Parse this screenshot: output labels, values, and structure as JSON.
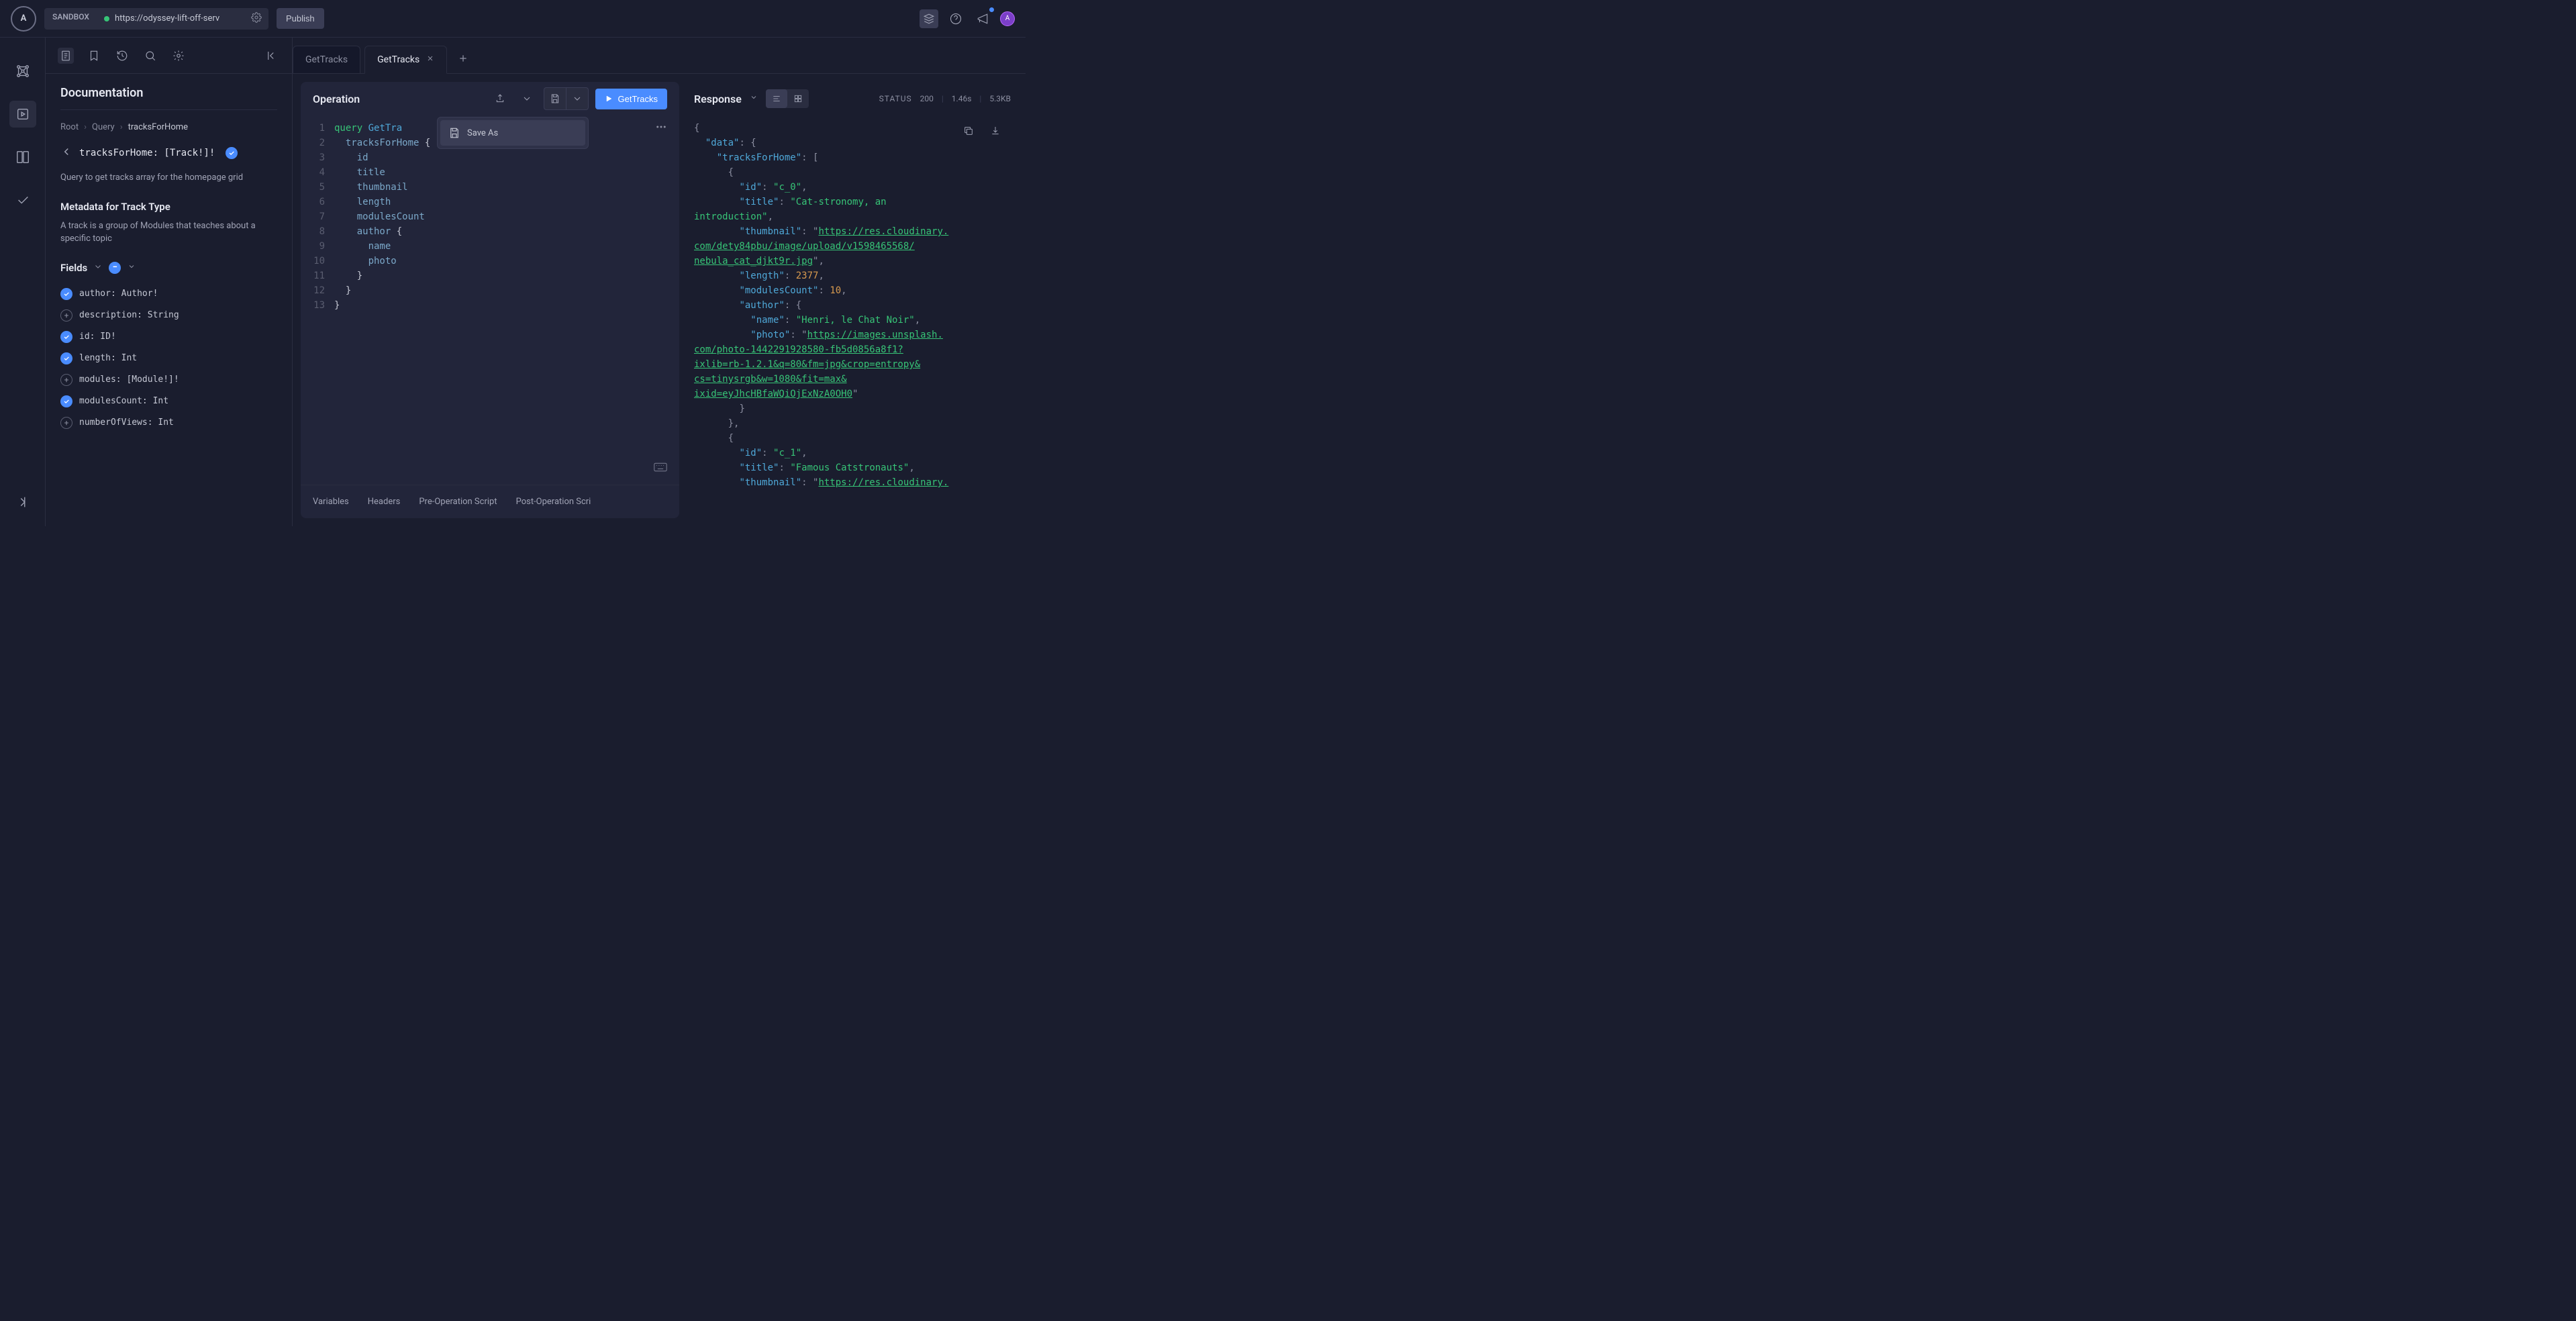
{
  "topbar": {
    "sandbox_label": "SANDBOX",
    "url": "https://odyssey-lift-off-serv",
    "publish": "Publish",
    "avatar_initial": "A"
  },
  "doc": {
    "title": "Documentation",
    "breadcrumb": [
      "Root",
      "Query",
      "tracksForHome"
    ],
    "back_signature": "tracksForHome: [Track!]!",
    "description": "Query to get tracks array for the homepage grid",
    "metadata_heading": "Metadata for Track Type",
    "metadata_desc": "A track is a group of Modules that teaches about a specific topic",
    "fields_label": "Fields",
    "fields": [
      {
        "on": true,
        "sig": "author: Author!"
      },
      {
        "on": false,
        "sig": "description: String"
      },
      {
        "on": true,
        "sig": "id: ID!"
      },
      {
        "on": true,
        "sig": "length: Int"
      },
      {
        "on": false,
        "sig": "modules: [Module!]!"
      },
      {
        "on": true,
        "sig": "modulesCount: Int"
      },
      {
        "on": false,
        "sig": "numberOfViews: Int"
      }
    ]
  },
  "tabs": {
    "items": [
      {
        "label": "GetTracks",
        "active": false
      },
      {
        "label": "GetTracks",
        "active": true
      }
    ]
  },
  "operation": {
    "title": "Operation",
    "run_label": "GetTracks",
    "save_as": "Save As",
    "code_lines": [
      [
        {
          "c": "tok-kw",
          "t": "query"
        },
        {
          "c": "",
          "t": " "
        },
        {
          "c": "tok-name",
          "t": "GetTra"
        }
      ],
      [
        {
          "c": "",
          "t": "  "
        },
        {
          "c": "tok-field",
          "t": "tracksForHome"
        },
        {
          "c": "",
          "t": " {"
        }
      ],
      [
        {
          "c": "",
          "t": "    "
        },
        {
          "c": "tok-field",
          "t": "id"
        }
      ],
      [
        {
          "c": "",
          "t": "    "
        },
        {
          "c": "tok-field",
          "t": "title"
        }
      ],
      [
        {
          "c": "",
          "t": "    "
        },
        {
          "c": "tok-field",
          "t": "thumbnail"
        }
      ],
      [
        {
          "c": "",
          "t": "    "
        },
        {
          "c": "tok-field",
          "t": "length"
        }
      ],
      [
        {
          "c": "",
          "t": "    "
        },
        {
          "c": "tok-field",
          "t": "modulesCount"
        }
      ],
      [
        {
          "c": "",
          "t": "    "
        },
        {
          "c": "tok-field",
          "t": "author"
        },
        {
          "c": "",
          "t": " {"
        }
      ],
      [
        {
          "c": "",
          "t": "      "
        },
        {
          "c": "tok-field",
          "t": "name"
        }
      ],
      [
        {
          "c": "",
          "t": "      "
        },
        {
          "c": "tok-field",
          "t": "photo"
        }
      ],
      [
        {
          "c": "",
          "t": "    }"
        }
      ],
      [
        {
          "c": "",
          "t": "  }"
        }
      ],
      [
        {
          "c": "",
          "t": "}"
        }
      ]
    ],
    "bottom_tabs": [
      "Variables",
      "Headers",
      "Pre-Operation Script",
      "Post-Operation Scri"
    ]
  },
  "response": {
    "title": "Response",
    "status_label": "STATUS",
    "status_code": "200",
    "time": "1.46s",
    "size": "5.3KB",
    "json_lines": [
      [
        {
          "c": "j-punc",
          "t": "{"
        }
      ],
      [
        {
          "c": "",
          "t": "  "
        },
        {
          "c": "j-key",
          "t": "\"data\""
        },
        {
          "c": "j-punc",
          "t": ": {"
        }
      ],
      [
        {
          "c": "",
          "t": "    "
        },
        {
          "c": "j-key",
          "t": "\"tracksForHome\""
        },
        {
          "c": "j-punc",
          "t": ": ["
        }
      ],
      [
        {
          "c": "",
          "t": "      "
        },
        {
          "c": "j-punc",
          "t": "{"
        }
      ],
      [
        {
          "c": "",
          "t": "        "
        },
        {
          "c": "j-key",
          "t": "\"id\""
        },
        {
          "c": "j-punc",
          "t": ": "
        },
        {
          "c": "j-str",
          "t": "\"c_0\""
        },
        {
          "c": "j-punc",
          "t": ","
        }
      ],
      [
        {
          "c": "",
          "t": "        "
        },
        {
          "c": "j-key",
          "t": "\"title\""
        },
        {
          "c": "j-punc",
          "t": ": "
        },
        {
          "c": "j-str",
          "t": "\"Cat-stronomy, an"
        }
      ],
      [
        {
          "c": "j-str",
          "t": "introduction\""
        },
        {
          "c": "j-punc",
          "t": ","
        }
      ],
      [
        {
          "c": "",
          "t": "        "
        },
        {
          "c": "j-key",
          "t": "\"thumbnail\""
        },
        {
          "c": "j-punc",
          "t": ": "
        },
        {
          "c": "j-punc",
          "t": "\""
        },
        {
          "c": "j-url",
          "t": "https://res.cloudinary."
        }
      ],
      [
        {
          "c": "j-url",
          "t": "com/dety84pbu/image/upload/v1598465568/"
        }
      ],
      [
        {
          "c": "j-url",
          "t": "nebula_cat_djkt9r.jpg"
        },
        {
          "c": "j-punc",
          "t": "\","
        }
      ],
      [
        {
          "c": "",
          "t": "        "
        },
        {
          "c": "j-key",
          "t": "\"length\""
        },
        {
          "c": "j-punc",
          "t": ": "
        },
        {
          "c": "j-num",
          "t": "2377"
        },
        {
          "c": "j-punc",
          "t": ","
        }
      ],
      [
        {
          "c": "",
          "t": "        "
        },
        {
          "c": "j-key",
          "t": "\"modulesCount\""
        },
        {
          "c": "j-punc",
          "t": ": "
        },
        {
          "c": "j-num",
          "t": "10"
        },
        {
          "c": "j-punc",
          "t": ","
        }
      ],
      [
        {
          "c": "",
          "t": "        "
        },
        {
          "c": "j-key",
          "t": "\"author\""
        },
        {
          "c": "j-punc",
          "t": ": {"
        }
      ],
      [
        {
          "c": "",
          "t": "          "
        },
        {
          "c": "j-key",
          "t": "\"name\""
        },
        {
          "c": "j-punc",
          "t": ": "
        },
        {
          "c": "j-str",
          "t": "\"Henri, le Chat Noir\""
        },
        {
          "c": "j-punc",
          "t": ","
        }
      ],
      [
        {
          "c": "",
          "t": "          "
        },
        {
          "c": "j-key",
          "t": "\"photo\""
        },
        {
          "c": "j-punc",
          "t": ": "
        },
        {
          "c": "j-punc",
          "t": "\""
        },
        {
          "c": "j-url",
          "t": "https://images.unsplash."
        }
      ],
      [
        {
          "c": "j-url",
          "t": "com/photo-1442291928580-fb5d0856a8f1?"
        }
      ],
      [
        {
          "c": "j-url",
          "t": "ixlib=rb-1.2.1&q=80&fm=jpg&crop=entropy&"
        }
      ],
      [
        {
          "c": "j-url",
          "t": "cs=tinysrgb&w=1080&fit=max&"
        }
      ],
      [
        {
          "c": "j-url",
          "t": "ixid=eyJhcHBfaWQiOjExNzA0OH0"
        },
        {
          "c": "j-punc",
          "t": "\""
        }
      ],
      [
        {
          "c": "",
          "t": "        "
        },
        {
          "c": "j-punc",
          "t": "}"
        }
      ],
      [
        {
          "c": "",
          "t": "      "
        },
        {
          "c": "j-punc",
          "t": "},"
        }
      ],
      [
        {
          "c": "",
          "t": "      "
        },
        {
          "c": "j-punc",
          "t": "{"
        }
      ],
      [
        {
          "c": "",
          "t": "        "
        },
        {
          "c": "j-key",
          "t": "\"id\""
        },
        {
          "c": "j-punc",
          "t": ": "
        },
        {
          "c": "j-str",
          "t": "\"c_1\""
        },
        {
          "c": "j-punc",
          "t": ","
        }
      ],
      [
        {
          "c": "",
          "t": "        "
        },
        {
          "c": "j-key",
          "t": "\"title\""
        },
        {
          "c": "j-punc",
          "t": ": "
        },
        {
          "c": "j-str",
          "t": "\"Famous Catstronauts\""
        },
        {
          "c": "j-punc",
          "t": ","
        }
      ],
      [
        {
          "c": "",
          "t": "        "
        },
        {
          "c": "j-key",
          "t": "\"thumbnail\""
        },
        {
          "c": "j-punc",
          "t": ": "
        },
        {
          "c": "j-punc",
          "t": "\""
        },
        {
          "c": "j-url",
          "t": "https://res.cloudinary."
        }
      ]
    ]
  }
}
